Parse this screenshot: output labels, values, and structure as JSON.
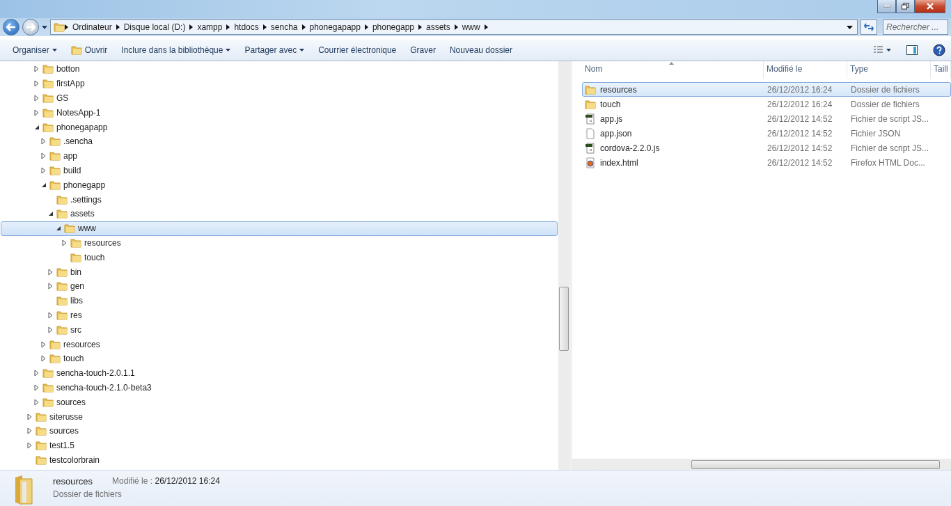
{
  "address": {
    "crumbs": [
      "Ordinateur",
      "Disque local (D:)",
      "xampp",
      "htdocs",
      "sencha",
      "phonegapapp",
      "phonegapp",
      "assets",
      "www"
    ]
  },
  "search": {
    "placeholder": "Rechercher ..."
  },
  "toolbar": [
    {
      "label": "Organiser",
      "kind": "menu"
    },
    {
      "label": "Ouvrir",
      "kind": "open"
    },
    {
      "label": "Inclure dans la bibliothèque",
      "kind": "menu"
    },
    {
      "label": "Partager avec",
      "kind": "menu"
    },
    {
      "label": "Courrier électronique",
      "kind": "plain"
    },
    {
      "label": "Graver",
      "kind": "plain"
    },
    {
      "label": "Nouveau dossier",
      "kind": "plain"
    }
  ],
  "tree": [
    {
      "kind": "hidden",
      "children": [
        {
          "label": "botton",
          "kind": "folder",
          "expanded": false,
          "selected": false
        },
        {
          "label": "firstApp",
          "kind": "folder",
          "expanded": false,
          "selected": false
        },
        {
          "label": "GS",
          "kind": "folder",
          "expanded": false,
          "selected": false
        },
        {
          "label": "NotesApp-1",
          "kind": "folder",
          "expanded": false,
          "selected": false
        },
        {
          "label": "phonegapapp",
          "kind": "folder",
          "expanded": true,
          "selected": false,
          "children": [
            {
              "label": ".sencha",
              "kind": "folder",
              "expanded": false,
              "selected": false
            },
            {
              "label": "app",
              "kind": "folder",
              "expanded": false,
              "selected": false
            },
            {
              "label": "build",
              "kind": "folder",
              "expanded": false,
              "selected": false
            },
            {
              "label": "phonegapp",
              "kind": "folder",
              "expanded": true,
              "selected": false,
              "children": [
                {
                  "label": ".settings",
                  "kind": "leaf",
                  "selected": false
                },
                {
                  "label": "assets",
                  "kind": "folder",
                  "expanded": true,
                  "selected": false,
                  "children": [
                    {
                      "label": "www",
                      "kind": "folder",
                      "expanded": true,
                      "selected": true,
                      "children": [
                        {
                          "label": "resources",
                          "kind": "folder",
                          "expanded": false,
                          "selected": false
                        },
                        {
                          "label": "touch",
                          "kind": "leaf",
                          "selected": false
                        }
                      ]
                    }
                  ]
                },
                {
                  "label": "bin",
                  "kind": "folder",
                  "expanded": false,
                  "selected": false
                },
                {
                  "label": "gen",
                  "kind": "folder",
                  "expanded": false,
                  "selected": false
                },
                {
                  "label": "libs",
                  "kind": "leaf",
                  "selected": false
                },
                {
                  "label": "res",
                  "kind": "folder",
                  "expanded": false,
                  "selected": false
                },
                {
                  "label": "src",
                  "kind": "folder",
                  "expanded": false,
                  "selected": false
                }
              ]
            },
            {
              "label": "resources",
              "kind": "folder",
              "expanded": false,
              "selected": false
            },
            {
              "label": "touch",
              "kind": "folder",
              "expanded": false,
              "selected": false
            }
          ]
        },
        {
          "label": "sencha-touch-2.0.1.1",
          "kind": "folder",
          "expanded": false,
          "selected": false
        },
        {
          "label": "sencha-touch-2.1.0-beta3",
          "kind": "folder",
          "expanded": false,
          "selected": false
        },
        {
          "label": "sources",
          "kind": "folder",
          "expanded": false,
          "selected": false
        }
      ]
    },
    {
      "label": "siterusse",
      "kind": "folder",
      "expanded": false,
      "selected": false
    },
    {
      "label": "sources",
      "kind": "folder",
      "expanded": false,
      "selected": false
    },
    {
      "label": "test1.5",
      "kind": "folder",
      "expanded": false,
      "selected": false
    },
    {
      "label": "testcolorbrain",
      "kind": "leaf",
      "selected": false
    }
  ],
  "files": {
    "columns": [
      "Nom",
      "Modifié le",
      "Type",
      "Taill"
    ],
    "rows": [
      {
        "kind": "folder",
        "name": "resources",
        "modified": "26/12/2012 16:24",
        "type": "Dossier de fichiers",
        "selected": true
      },
      {
        "kind": "folder",
        "name": "touch",
        "modified": "26/12/2012 16:24",
        "type": "Dossier de fichiers",
        "selected": false
      },
      {
        "kind": "script",
        "name": "app.js",
        "modified": "26/12/2012 14:52",
        "type": "Fichier de script JS...",
        "selected": false
      },
      {
        "kind": "blank",
        "name": "app.json",
        "modified": "26/12/2012 14:52",
        "type": "Fichier JSON",
        "selected": false
      },
      {
        "kind": "script",
        "name": "cordova-2.2.0.js",
        "modified": "26/12/2012 14:52",
        "type": "Fichier de script JS...",
        "selected": false
      },
      {
        "kind": "firefox",
        "name": "index.html",
        "modified": "26/12/2012 14:52",
        "type": "Firefox HTML Doc...",
        "selected": false
      }
    ]
  },
  "details": {
    "name": "resources",
    "modified_label": "Modifié le :",
    "modified": "26/12/2012 16:24",
    "type": "Dossier de fichiers"
  }
}
